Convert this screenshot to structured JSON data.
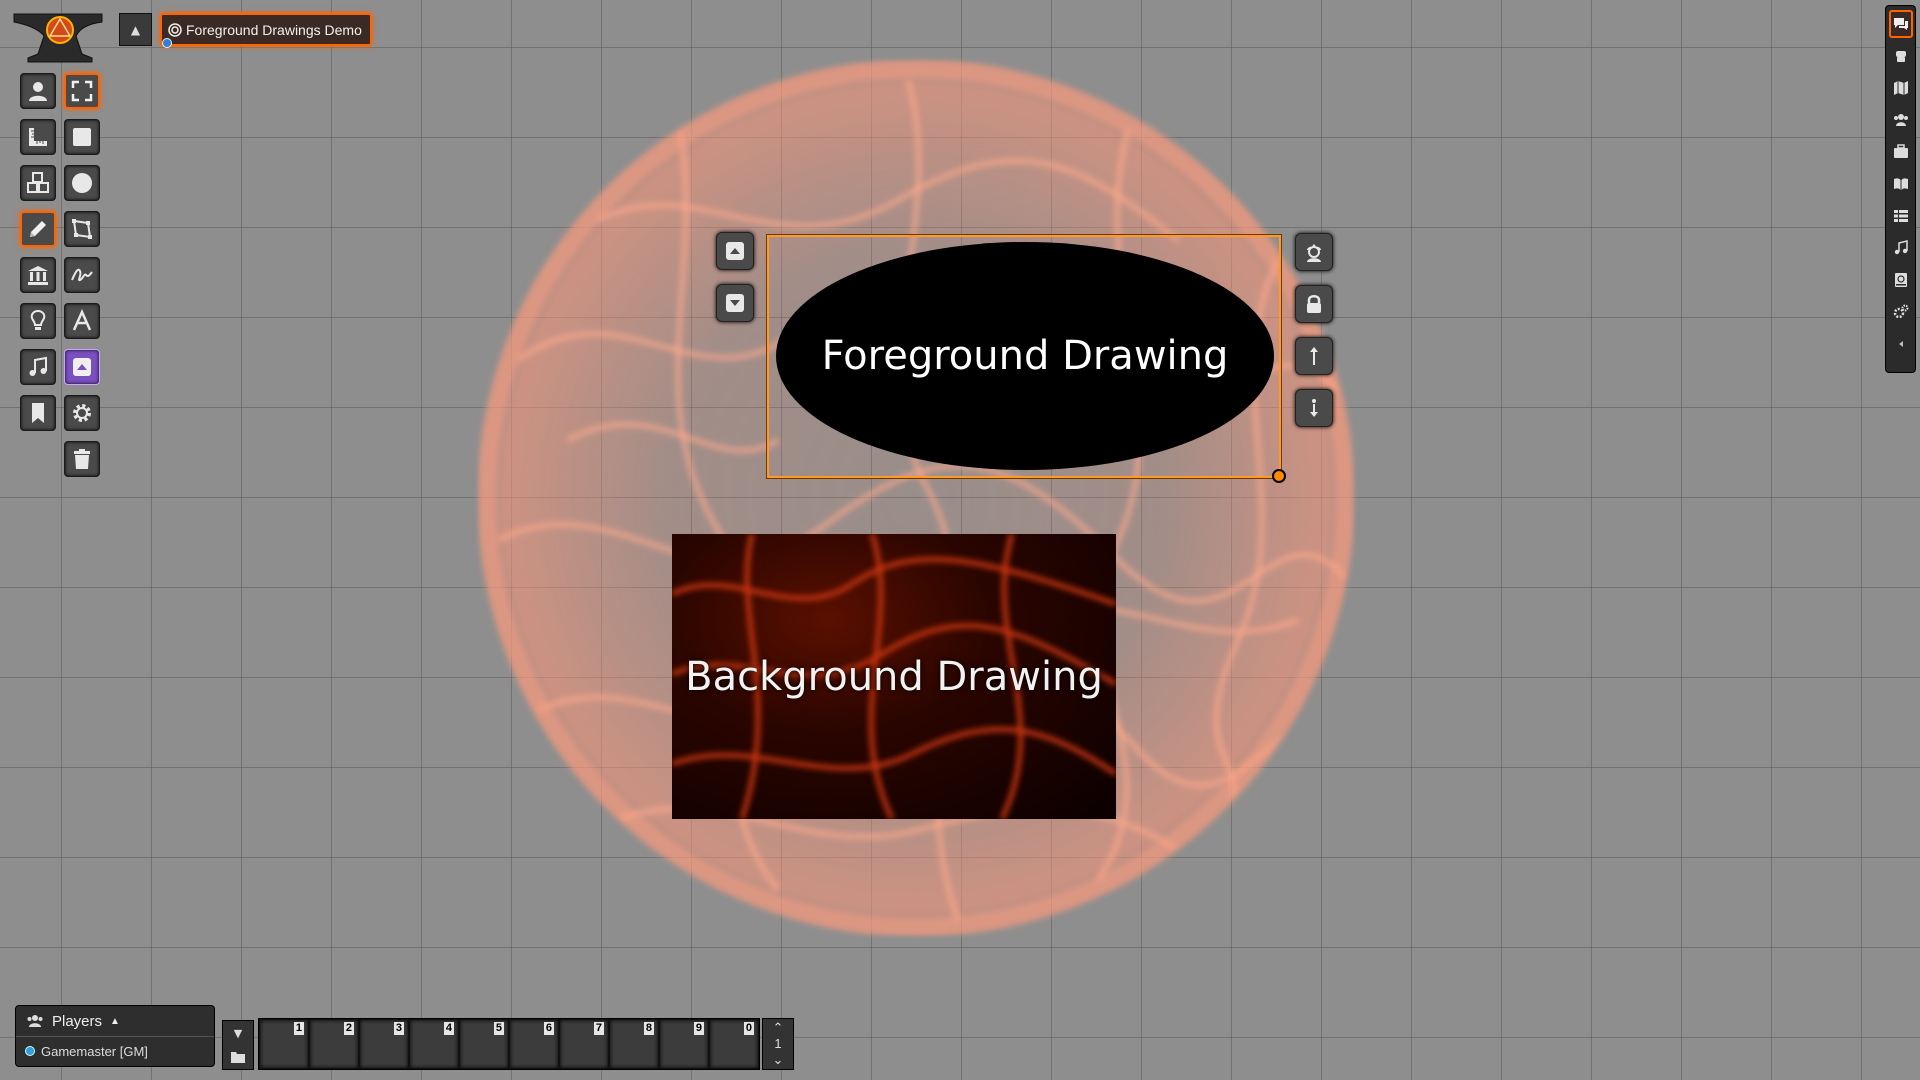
{
  "scene_navigation": {
    "toggle_icon": "caret-up-icon",
    "active_scene": {
      "name": "Foreground Drawings Demo",
      "icon": "bullseye-icon"
    }
  },
  "scene_controls": [
    {
      "name": "token-controls",
      "icon": "user-icon",
      "active": false
    },
    {
      "name": "measurement-controls",
      "icon": "ruler-icon",
      "active": false
    },
    {
      "name": "tile-controls",
      "icon": "cubes-icon",
      "active": false
    },
    {
      "name": "drawing-controls",
      "icon": "pencil-icon",
      "active": true
    },
    {
      "name": "wall-controls",
      "icon": "landmark-icon",
      "active": false
    },
    {
      "name": "lighting-controls",
      "icon": "lightbulb-icon",
      "active": false
    },
    {
      "name": "sound-controls",
      "icon": "music-icon",
      "active": false
    },
    {
      "name": "notes-controls",
      "icon": "bookmark-icon",
      "active": false
    }
  ],
  "drawing_tools": [
    {
      "name": "select-tool",
      "icon": "expand-icon",
      "active": true
    },
    {
      "name": "rectangle-tool",
      "icon": "square-icon",
      "active": false
    },
    {
      "name": "ellipse-tool",
      "icon": "circle-icon",
      "active": false
    },
    {
      "name": "polygon-tool",
      "icon": "draw-polygon-icon",
      "active": false
    },
    {
      "name": "freehand-tool",
      "icon": "signature-icon",
      "active": false
    },
    {
      "name": "text-tool",
      "icon": "font-icon",
      "active": false
    },
    {
      "name": "foreground-toggle",
      "icon": "caret-square-up-icon",
      "toggled": true
    },
    {
      "name": "configure-tool",
      "icon": "cog-icon",
      "active": false
    },
    {
      "name": "clear-tool",
      "icon": "trash-icon",
      "active": false
    }
  ],
  "canvas": {
    "foreground_drawing": {
      "text": "Foreground Drawing",
      "fill": "#000000",
      "frame_color": "#ff9a2a"
    },
    "background_drawing": {
      "text": "Background Drawing"
    }
  },
  "drawing_hud": {
    "left": [
      {
        "name": "bring-to-front-button",
        "icon": "caret-square-up-icon"
      },
      {
        "name": "send-to-back-button",
        "icon": "caret-square-down-icon"
      }
    ],
    "right": [
      {
        "name": "visibility-toggle",
        "icon": "user-secret-icon"
      },
      {
        "name": "lock-toggle",
        "icon": "lock-icon"
      },
      {
        "name": "raise-elevation-button",
        "icon": "arrow-up-icon"
      },
      {
        "name": "lower-elevation-button",
        "icon": "arrow-down-icon"
      }
    ]
  },
  "sidebar_tabs": [
    {
      "name": "chat",
      "icon": "comments-icon",
      "active": true
    },
    {
      "name": "combat",
      "icon": "fist-icon",
      "active": false
    },
    {
      "name": "scenes",
      "icon": "map-icon",
      "active": false
    },
    {
      "name": "actors",
      "icon": "users-icon",
      "active": false
    },
    {
      "name": "items",
      "icon": "suitcase-icon",
      "active": false
    },
    {
      "name": "journal",
      "icon": "book-open-icon",
      "active": false
    },
    {
      "name": "tables",
      "icon": "th-list-icon",
      "active": false
    },
    {
      "name": "playlists",
      "icon": "music-icon",
      "active": false
    },
    {
      "name": "compendium",
      "icon": "atlas-icon",
      "active": false
    },
    {
      "name": "settings",
      "icon": "cogs-icon",
      "active": false
    },
    {
      "name": "collapse",
      "icon": "caret-left-icon",
      "active": false
    }
  ],
  "players": {
    "title": "Players",
    "list": [
      {
        "name": "Gamemaster [GM]",
        "color": "#2f9de0"
      }
    ]
  },
  "hotbar": {
    "slots": [
      "1",
      "2",
      "3",
      "4",
      "5",
      "6",
      "7",
      "8",
      "9",
      "0"
    ],
    "page": "1"
  },
  "accent_color": "#ff6400"
}
